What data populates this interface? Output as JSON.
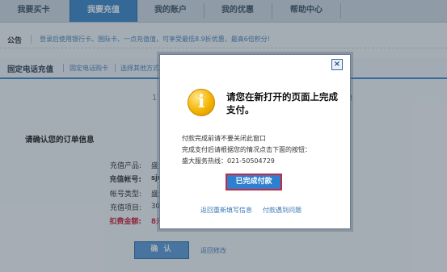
{
  "nav": {
    "tabs": [
      {
        "label": "我要买卡"
      },
      {
        "label": "我要充值"
      },
      {
        "label": "我的账户"
      },
      {
        "label": "我的优惠"
      },
      {
        "label": "帮助中心"
      }
    ],
    "active_tab": 1
  },
  "notice": {
    "title": "公告",
    "text": "登录后使用银行卡、国际卡、一点充值值，可享受最低8.9折优惠，最高6倍积分!"
  },
  "section": {
    "title": "固定电话充值",
    "links": [
      "固定电话购卡",
      "选择其他方式"
    ]
  },
  "steps": {
    "number": "1",
    "right_text": "付"
  },
  "confirm": {
    "title": "请确认您的订单信息",
    "rows": [
      {
        "label": "充值产品:",
        "value": "盛大"
      },
      {
        "label": "充值帐号:",
        "value": "sju"
      },
      {
        "label": "帐号类型:",
        "value": "盛大"
      },
      {
        "label": "充值项目:",
        "value": "300"
      },
      {
        "label": "扣费金额:",
        "value": "8元"
      }
    ],
    "confirm_button": "确 认",
    "back_link": "返回修改"
  },
  "dialog": {
    "close_icon": "×",
    "icon_glyph": "i",
    "heading": "请您在新打开的页面上完成支付。",
    "line1": "付款完成前请不要关闭此窗口",
    "line2": "完成支付后请根据您的情况点击下面的按钮：",
    "line3": "盛大服务热线：021-50504729",
    "done_button": "已完成付款",
    "link_left": "返回重新填写信息",
    "link_right": "付款遇到问题"
  },
  "colors": {
    "accent": "#3d87c7",
    "link": "#4a82bd",
    "alert": "#c8283c"
  }
}
